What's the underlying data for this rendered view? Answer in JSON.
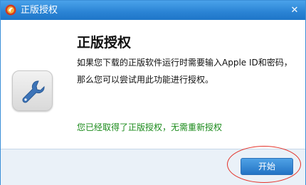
{
  "window": {
    "title": "正版授权",
    "close_label": "✕"
  },
  "main": {
    "heading": "正版授权",
    "description_line1": "如果您下载的正版软件运行时需要输入Apple ID和密码，",
    "description_line2": "那么您可以尝试用此功能进行授权。",
    "status_message": "您已经取得了正版授权，无需重新授权"
  },
  "footer": {
    "start_label": "开始"
  },
  "icons": {
    "app": "app-logo-icon",
    "tool": "wrench-icon"
  },
  "colors": {
    "titlebar": "#2a83d4",
    "status_text": "#1a8a1a",
    "button": "#2373c4",
    "annotation": "#e4332a"
  }
}
